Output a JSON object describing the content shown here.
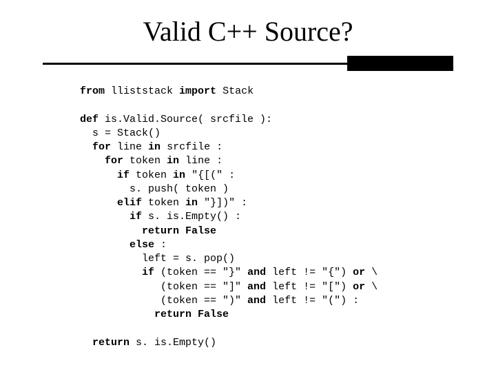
{
  "title": "Valid C++ Source?",
  "code": {
    "l1a": "from",
    "l1b": " lliststack ",
    "l1c": "import",
    "l1d": " Stack",
    "l2": "",
    "l3a": "def",
    "l3b": " is.Valid.Source( srcfile ):",
    "l4": "  s = Stack()",
    "l5a": "  ",
    "l5b": "for",
    "l5c": " line ",
    "l5d": "in",
    "l5e": " srcfile :",
    "l6a": "    ",
    "l6b": "for",
    "l6c": " token ",
    "l6d": "in",
    "l6e": " line :",
    "l7a": "      ",
    "l7b": "if",
    "l7c": " token ",
    "l7d": "in",
    "l7e": " \"{[(\" :",
    "l8": "        s. push( token )",
    "l9a": "      ",
    "l9b": "elif",
    "l9c": " token ",
    "l9d": "in",
    "l9e": " \"}])\" :",
    "l10a": "        ",
    "l10b": "if",
    "l10c": " s. is.Empty() :",
    "l11a": "          ",
    "l11b": "return False",
    "l12a": "        ",
    "l12b": "else",
    "l12c": " :",
    "l13": "          left = s. pop()",
    "l14a": "          ",
    "l14b": "if",
    "l14c": " (token == \"}\" ",
    "l14d": "and",
    "l14e": " left != \"{\") ",
    "l14f": "or",
    "l14g": " \\",
    "l15a": "             (token == \"]\" ",
    "l15b": "and",
    "l15c": " left != \"[\") ",
    "l15d": "or",
    "l15e": " \\",
    "l16a": "             (token == \")\" ",
    "l16b": "and",
    "l16c": " left != \"(\") :",
    "l17a": "            ",
    "l17b": "return False",
    "l18": "",
    "l19a": "  ",
    "l19b": "return",
    "l19c": " s. is.Empty()"
  }
}
